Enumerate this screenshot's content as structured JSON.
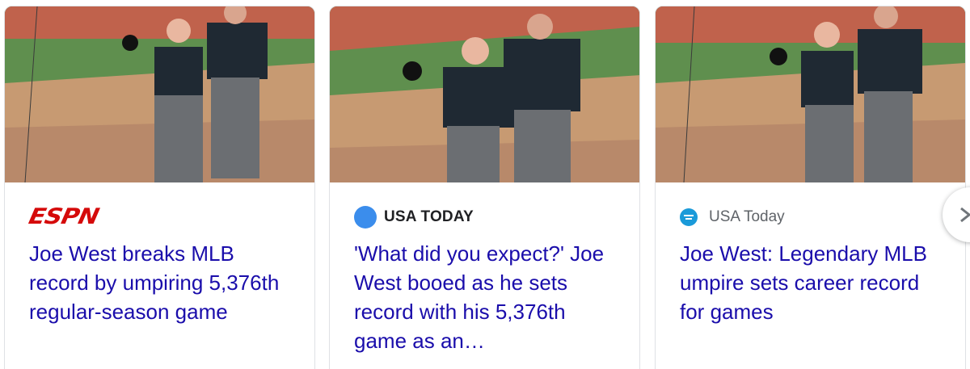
{
  "cards": [
    {
      "source": "ESPN",
      "source_icon": "espn-logo",
      "headline": "Joe West breaks MLB record by umpiring 5,376th regular-season game"
    },
    {
      "source": "USA TODAY",
      "source_icon": "usa-today-dot-icon",
      "headline": "'What did you expect?' Joe West booed as he sets record with his 5,376th game as an…"
    },
    {
      "source": "USA Today",
      "source_icon": "usa-today-favicon",
      "headline": "Joe West: Legendary MLB umpire sets career record for games"
    }
  ],
  "next_button_icon": "chevron-right-icon",
  "colors": {
    "headline_link": "#1a0dab",
    "espn_red": "#d50a0a",
    "usa_today_blue": "#3b8dec",
    "card_border": "#dfe1e5"
  }
}
